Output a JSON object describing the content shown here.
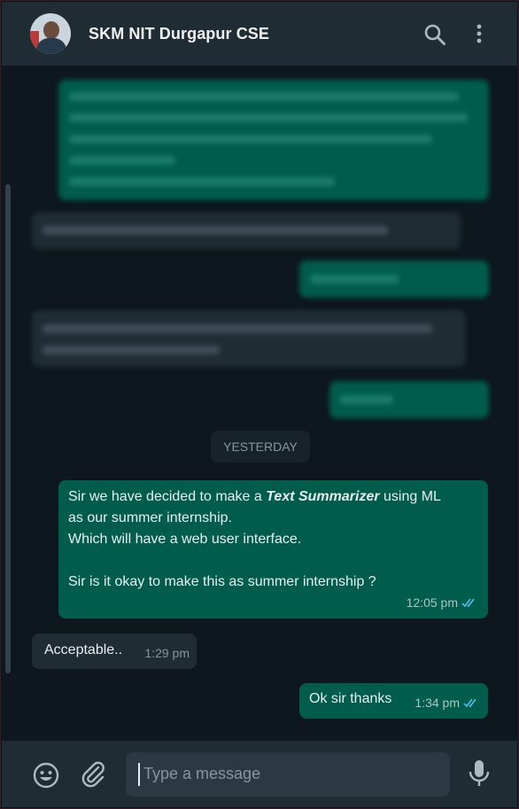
{
  "header": {
    "title": "SKM NIT Durgapur CSE",
    "icons": [
      "avatar",
      "search-icon",
      "menu-icon"
    ]
  },
  "chat": {
    "date_separator": "YESTERDAY",
    "messages": [
      {
        "direction": "outgoing",
        "text_before": "Sir we have decided to make a ",
        "text_emphasis": "Text Summarizer",
        "text_after": " using ML",
        "line2": "as our summer internship.",
        "line3": "Which will have a web user interface.",
        "line4": "Sir is it okay to make this as summer internship ?",
        "time": "12:05 pm",
        "status": "read"
      },
      {
        "direction": "incoming",
        "text": "Acceptable..",
        "time": "1:29 pm"
      },
      {
        "direction": "outgoing",
        "text": "Ok sir thanks",
        "time": "1:34 pm",
        "status": "read"
      }
    ]
  },
  "composer": {
    "placeholder": "Type a message",
    "icons": [
      "emoji-icon",
      "attach-icon",
      "mic-icon"
    ]
  },
  "colors": {
    "header_bg": "#202c33",
    "chat_bg": "#0d171d",
    "outgoing_bubble": "#005c4b",
    "incoming_bubble": "#1f2c34",
    "read_ticks": "#53bdeb"
  }
}
